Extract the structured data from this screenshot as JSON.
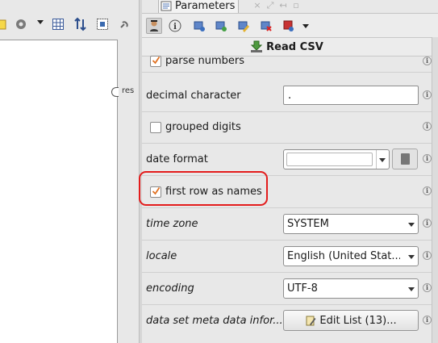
{
  "left_panel": {
    "port_label": "res"
  },
  "panel": {
    "tab_title": "Parameters",
    "operator_name": "Read CSV"
  },
  "params": {
    "parse_numbers": {
      "label": "parse numbers",
      "checked": true
    },
    "decimal_character": {
      "label": "decimal character",
      "value": "."
    },
    "grouped_digits": {
      "label": "grouped digits",
      "checked": false
    },
    "date_format": {
      "label": "date format",
      "value": ""
    },
    "first_row_as_names": {
      "label": "first row as names",
      "checked": true
    },
    "time_zone": {
      "label": "time zone",
      "value": "SYSTEM"
    },
    "locale": {
      "label": "locale",
      "value": "English (United Stat..."
    },
    "encoding": {
      "label": "encoding",
      "value": "UTF-8"
    },
    "data_set_meta": {
      "label": "data set meta data infor...",
      "button_label": "Edit List (13)..."
    }
  },
  "icons": {
    "info": "i",
    "tab_controls": [
      "×",
      "⤢",
      "↤",
      "▫"
    ]
  },
  "colors": {
    "highlight": "#e31c1c",
    "check": "#e07020"
  }
}
